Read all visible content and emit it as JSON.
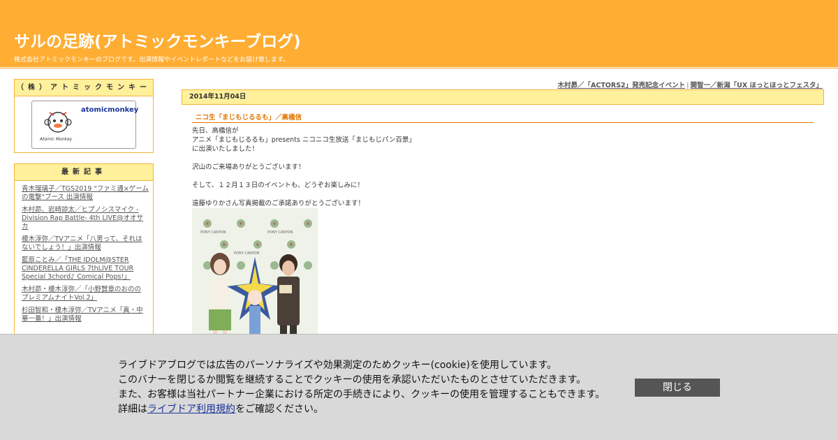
{
  "header": {
    "title": "サルの足跡(アトミックモンキーブログ)",
    "description": "株式会社アトミックモンキーのブログです。出演情報やイベントレポートなどをお届け致します。"
  },
  "profile": {
    "heading": "（株）アトミックモンキー",
    "name": "atomicmonkey",
    "logo_text": "Atomic Monkey"
  },
  "recent": {
    "heading": "最新記事",
    "items": [
      "青木瑠璃子／TGS2019 \"ファミ通×ゲームの電撃\"ブース 出演情報",
      "木村昴、岩崎諒太／ヒプノシスマイク -Division Rap Battle- 4th LIVE@オオサカ",
      "榎木淳弥／TVアニメ「八男って、それはないでしょう！」出演情報",
      "藍原ことみ／「THE IDOLM@STER CINDERELLA GIRLS 7thLIVE TOUR Special 3chord♪ Comical Pops!」",
      "木村昴・榎木淳弥／「小野賢章のおのの  プレミアムナイトVol.2」",
      "杉田智和・榎木淳弥／TVアニメ「真・中華一番！」出演情報"
    ]
  },
  "nav": {
    "prev": "木村昴／「ACTORS2」発売記念イベント",
    "separator": "|",
    "next": "関智一／新潟「UX ほっとほっとフェスタ」"
  },
  "entry": {
    "date": "2014年11月04日",
    "title": "ニコ生「まじもじるるも」／高橋信",
    "lines": [
      "先日、高橋信が",
      "アニメ「まじもじるるも」presents ニコニコ生放送「まじもじパン百景」",
      "に出演いたしました！",
      "",
      "沢山のご来場ありがとうございます！",
      "",
      "そして、１２月１３日のイベントも、どうぞお楽しみに！",
      "",
      "遠藤ゆりかさん写真掲載のご承諾ありがとうございます！"
    ],
    "photo_logo": "PONY CANYON"
  },
  "cookie": {
    "line1": "ライブドアブログでは広告のパーソナライズや効果測定のためクッキー(cookie)を使用しています。",
    "line2": "このバナーを閉じるか閲覧を継続することでクッキーの使用を承認いただいたものとさせていただきます。",
    "line3": "また、お客様は当社パートナー企業における所定の手続きにより、クッキーの使用を管理することもできます。",
    "line4_prefix": "詳細は",
    "line4_link": "ライブドア利用規約",
    "line4_suffix": "をご確認ください。",
    "close_label": "閉じる"
  },
  "colors": {
    "header": "#ffad33",
    "box_head": "#fff09c",
    "entry_title": "#e07800",
    "banner": "#d9d9d9"
  }
}
